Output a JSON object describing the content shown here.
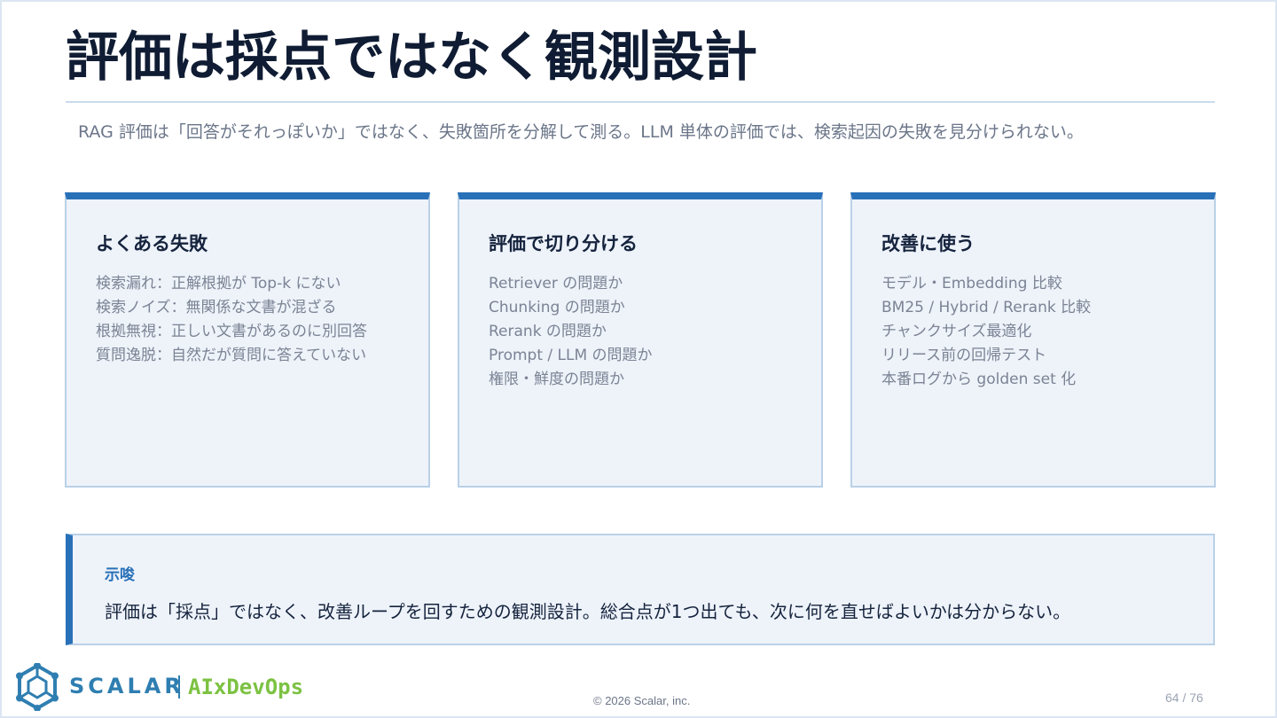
{
  "slide": {
    "title": "評価は採点ではなく観測設計",
    "subtitle": "RAG 評価は「回答がそれっぽいか」ではなく、失敗箇所を分解して測る。LLM 単体の評価では、検索起因の失敗を見分けられない。"
  },
  "cards": [
    {
      "title": "よくある失敗",
      "items": [
        "検索漏れ：正解根拠が Top-k にない",
        "検索ノイズ：無関係な文書が混ざる",
        "根拠無視：正しい文書があるのに別回答",
        "質問逸脱：自然だが質問に答えていない"
      ]
    },
    {
      "title": "評価で切り分ける",
      "items": [
        "Retriever の問題か",
        "Chunking の問題か",
        "Rerank の問題か",
        "Prompt / LLM の問題か",
        "権限・鮮度の問題か"
      ]
    },
    {
      "title": "改善に使う",
      "items": [
        "モデル・Embedding 比較",
        "BM25 / Hybrid / Rerank 比較",
        "チャンクサイズ最適化",
        "リリース前の回帰テスト",
        "本番ログから golden set 化"
      ]
    }
  ],
  "callout": {
    "label": "示唆",
    "text": "評価は「採点」ではなく、改善ループを回すための観測設計。総合点が1つ出ても、次に何を直せばよいかは分からない。"
  },
  "footer": {
    "brand": "SCALAR",
    "brand_sub": "AIxDevOps",
    "copyright": "© 2026 Scalar, inc.",
    "page": "64 / 76",
    "logo_icon": "scalar-logo-icon"
  },
  "colors": {
    "accent": "#2870b8",
    "card_bg": "#eef3fa",
    "brand_blue": "#2f7eb1",
    "brand_green": "#7cc242"
  }
}
